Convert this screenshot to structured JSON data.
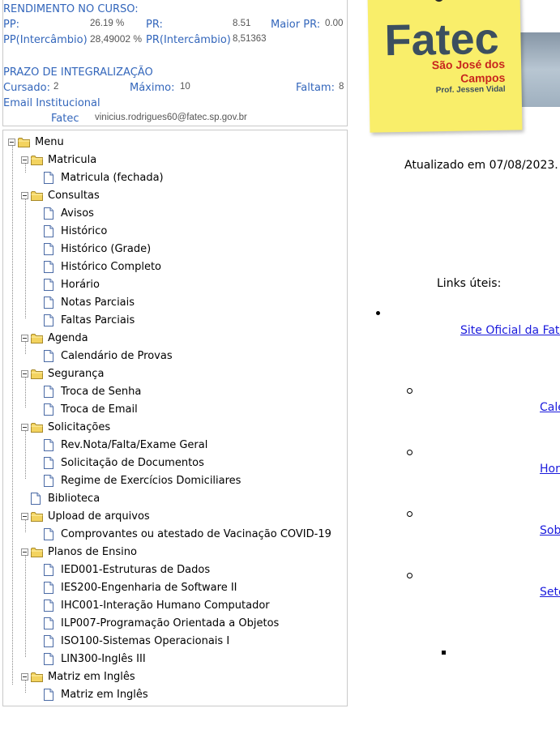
{
  "rendimento": {
    "title": "RENDIMENTO NO CURSO:",
    "pp_label": "PP:",
    "pp_value": "26.19 %",
    "pr_label": "PR:",
    "pr_value": "8.51",
    "maior_pr_label": "Maior PR:",
    "maior_pr_value": "0.00",
    "pp_inter_label": "PP(Intercâmbio)",
    "pp_inter_value": "28,49002 %",
    "pr_inter_label": "PR(Intercâmbio)",
    "pr_inter_value": "8,51363"
  },
  "prazo": {
    "title": "PRAZO DE INTEGRALIZAÇÃO",
    "cursado_label": "Cursado:",
    "cursado_value": "2",
    "maximo_label": "Máximo:",
    "maximo_value": "10",
    "faltam_label": "Faltam:",
    "faltam_value": "8"
  },
  "email": {
    "title": "Email Institucional",
    "label": "Fatec",
    "value": "vinicius.rodrigues60@fatec.sp.gov.br"
  },
  "menu": {
    "root": "Menu",
    "matricula": {
      "label": "Matricula",
      "items": [
        "Matricula (fechada)"
      ]
    },
    "consultas": {
      "label": "Consultas",
      "items": [
        "Avisos",
        "Histórico",
        "Histórico (Grade)",
        "Histórico Completo",
        "Horário",
        "Notas Parciais",
        "Faltas Parciais"
      ]
    },
    "agenda": {
      "label": "Agenda",
      "items": [
        "Calendário de Provas"
      ]
    },
    "seguranca": {
      "label": "Segurança",
      "items": [
        "Troca de Senha",
        "Troca de Email"
      ]
    },
    "solicitacoes": {
      "label": "Solicitações",
      "items": [
        "Rev.Nota/Falta/Exame Geral",
        "Solicitação de Documentos",
        "Regime de Exercícios Domiciliares"
      ]
    },
    "biblioteca": "Biblioteca",
    "upload": {
      "label": "Upload de arquivos",
      "items": [
        "Comprovantes ou atestado de Vacinação COVID-19"
      ]
    },
    "planos": {
      "label": "Planos de Ensino",
      "items": [
        "IED001-Estruturas de Dados",
        "IES200-Engenharia de Software II",
        "IHC001-Interação Humano Computador",
        "ILP007-Programação Orientada a Objetos",
        "ISO100-Sistemas Operacionais I",
        "LIN300-Inglês III"
      ]
    },
    "matriz": {
      "label": "Matriz em Inglês",
      "items": [
        "Matriz em Inglês"
      ]
    }
  },
  "logo": {
    "name": "Fatec",
    "line1": "São José dos",
    "line2": "Campos",
    "line3": "Prof. Jessen Vidal",
    "colors": {
      "paper": "#f9ee6a",
      "text": "#3c4f5f",
      "accent": "#c8261e"
    }
  },
  "updated_text": "Atualizado em 07/08/2023.",
  "links": {
    "title": "Links úteis:",
    "site": "Site Oficial da Fatec",
    "sub": [
      "Cale",
      "Hora",
      "Sob",
      "Seto"
    ]
  },
  "colors": {
    "label": "#3366bb",
    "link": "#1a1adc",
    "border": "#c9c9c9"
  }
}
